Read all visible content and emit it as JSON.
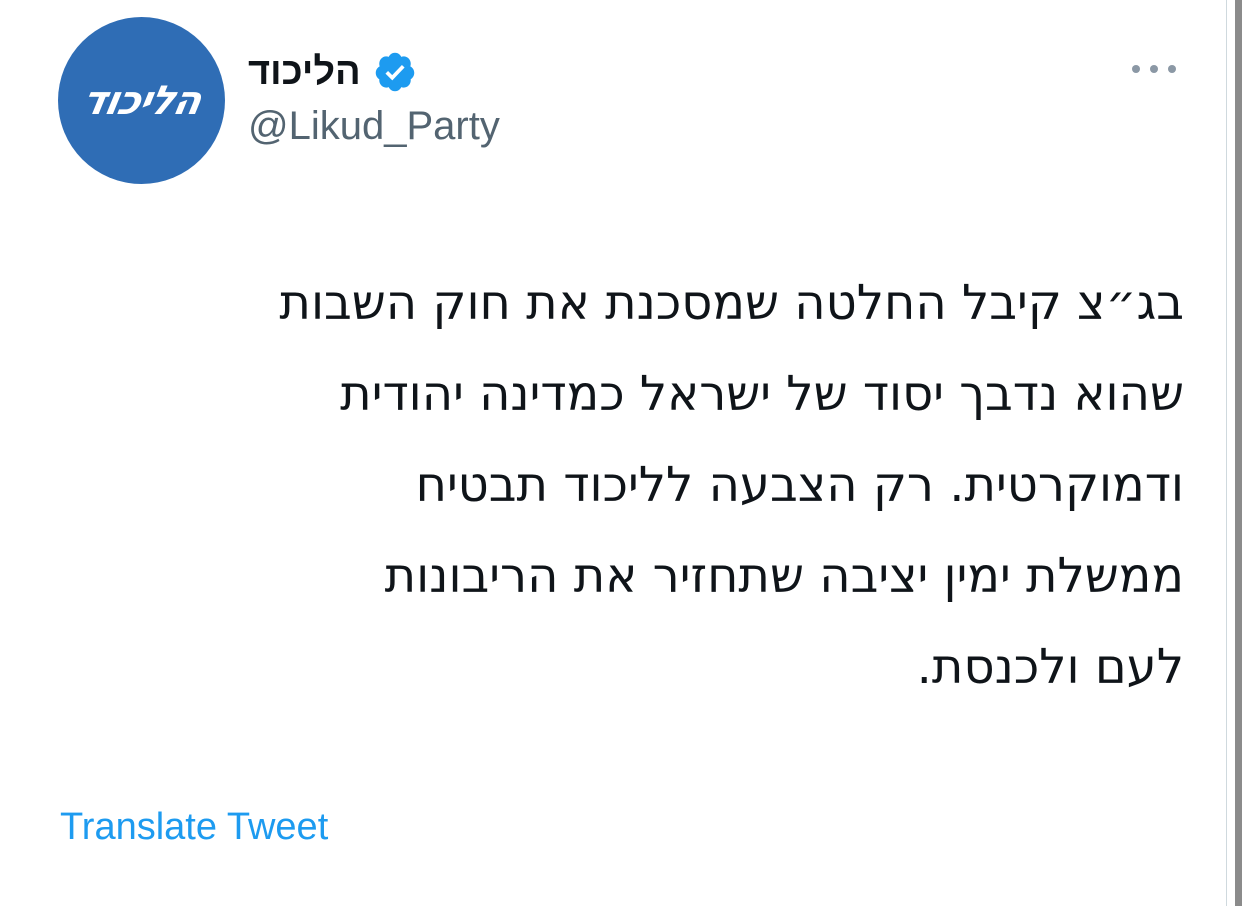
{
  "author": {
    "display_name": "הליכוד",
    "handle": "@Likud_Party",
    "verified": true,
    "avatar_text": "הליכוד",
    "avatar_color": "#2f6db5"
  },
  "tweet": {
    "lines": [
      "בג״צ קיבל החלטה שמסכנת את חוק השבות",
      "שהוא נדבך יסוד של ישראל כמדינה יהודית",
      "ודמוקרטית. רק הצבעה לליכוד תבטיח",
      "ממשלת ימין יציבה שתחזיר את הריבונות",
      "לעם ולכנסת."
    ]
  },
  "actions": {
    "translate_label": "Translate Tweet",
    "more_icon": "more-horizontal-icon"
  },
  "colors": {
    "text_primary": "#0f1419",
    "text_secondary": "#536471",
    "link": "#1d9bf0",
    "verified_badge": "#1d9bf0"
  }
}
